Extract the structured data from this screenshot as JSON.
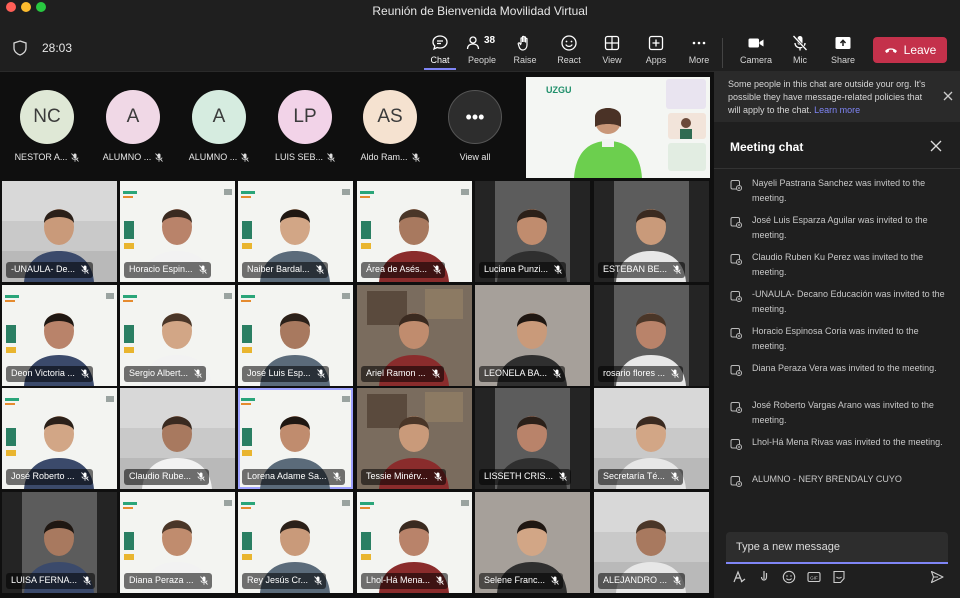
{
  "window": {
    "title": "Reunión de Bienvenida Movilidad Virtual"
  },
  "toolbar": {
    "timer": "28:03",
    "buttons": [
      {
        "key": "chat",
        "label": "Chat",
        "icon": "chat-icon",
        "active": true
      },
      {
        "key": "people",
        "label": "People",
        "icon": "people-icon",
        "count": "38"
      },
      {
        "key": "raise",
        "label": "Raise",
        "icon": "raise-hand-icon"
      },
      {
        "key": "react",
        "label": "React",
        "icon": "react-icon"
      },
      {
        "key": "view",
        "label": "View",
        "icon": "view-icon"
      },
      {
        "key": "apps",
        "label": "Apps",
        "icon": "apps-icon"
      },
      {
        "key": "more",
        "label": "More",
        "icon": "more-icon"
      },
      {
        "key": "camera",
        "label": "Camera",
        "icon": "camera-icon"
      },
      {
        "key": "mic",
        "label": "Mic",
        "icon": "mic-off-icon"
      },
      {
        "key": "share",
        "label": "Share",
        "icon": "share-icon"
      }
    ],
    "leave_label": "Leave"
  },
  "avatars": [
    {
      "initials": "NC",
      "name": "NESTOR A...",
      "color": "#dfe8d6"
    },
    {
      "initials": "A",
      "name": "ALUMNO ...",
      "color": "#f0d8e6"
    },
    {
      "initials": "A",
      "name": "ALUMNO ...",
      "color": "#d6ece0"
    },
    {
      "initials": "LP",
      "name": "LUIS SEB...",
      "color": "#f2d3e8"
    },
    {
      "initials": "AS",
      "name": "Aldo Ram...",
      "color": "#f5e2d0"
    }
  ],
  "view_all_label": "View all",
  "spotlight": {
    "logo_text": "UZGU"
  },
  "tiles": [
    {
      "name": "-UNAULA- De...",
      "bg": "room"
    },
    {
      "name": "Horacio Espin...",
      "bg": "uz"
    },
    {
      "name": "Naiber Bardal...",
      "bg": "uz"
    },
    {
      "name": "Área de Asés...",
      "bg": "uz"
    },
    {
      "name": "Luciana Punzi...",
      "bg": "dark"
    },
    {
      "name": "ESTEBAN BE...",
      "bg": "dark"
    },
    {
      "name": "Deon Victoria ...",
      "bg": "uz"
    },
    {
      "name": "Sergio Albert...",
      "bg": "uz"
    },
    {
      "name": "José Luis Esp...",
      "bg": "uz"
    },
    {
      "name": "Ariel Ramon ...",
      "bg": "office"
    },
    {
      "name": "LEONELA BA...",
      "bg": "grey"
    },
    {
      "name": "rosario flores ...",
      "bg": "dark"
    },
    {
      "name": "José Roberto ...",
      "bg": "uz"
    },
    {
      "name": "Claudio Rube...",
      "bg": "room"
    },
    {
      "name": "Lorena Adame Sa...",
      "bg": "uz",
      "speaking": true
    },
    {
      "name": "Tessie Minérv...",
      "bg": "office"
    },
    {
      "name": "LISSETH CRIS...",
      "bg": "dark"
    },
    {
      "name": "Secretaría Té...",
      "bg": "room"
    },
    {
      "name": "LUISA FERNA...",
      "bg": "dark"
    },
    {
      "name": "Diana Peraza ...",
      "bg": "uz"
    },
    {
      "name": "Rey Jesús Cr...",
      "bg": "uz"
    },
    {
      "name": "Lhol-Há Mena...",
      "bg": "uz"
    },
    {
      "name": "Selene Franc...",
      "bg": "grey"
    },
    {
      "name": "ALEJANDRO ...",
      "bg": "room"
    }
  ],
  "chat": {
    "banner_text": "Some people in this chat are outside your org. It's possible they have message-related policies that will apply to the chat.",
    "banner_link": "Learn more",
    "title": "Meeting chat",
    "messages": [
      "Nayeli Pastrana Sanchez was invited to the meeting.",
      "José Luis Esparza Aguilar was invited to the meeting.",
      "Claudio Ruben Ku Perez was invited to the meeting.",
      "-UNAULA- Decano Educación was invited to the meeting.",
      "Horacio Espinosa Coria was invited to the meeting.",
      "Diana Peraza Vera was invited to the meeting.",
      "José Roberto Vargas Arano was invited to the meeting.",
      "Lhol-Há Mena Rivas was invited to the meeting.",
      "ALUMNO - NERY BRENDALY CUYO"
    ],
    "placeholder": "Type a new message"
  },
  "colors": {
    "accent": "#7f85f5",
    "leave": "#c4314b",
    "panel": "#1f1f1f"
  }
}
